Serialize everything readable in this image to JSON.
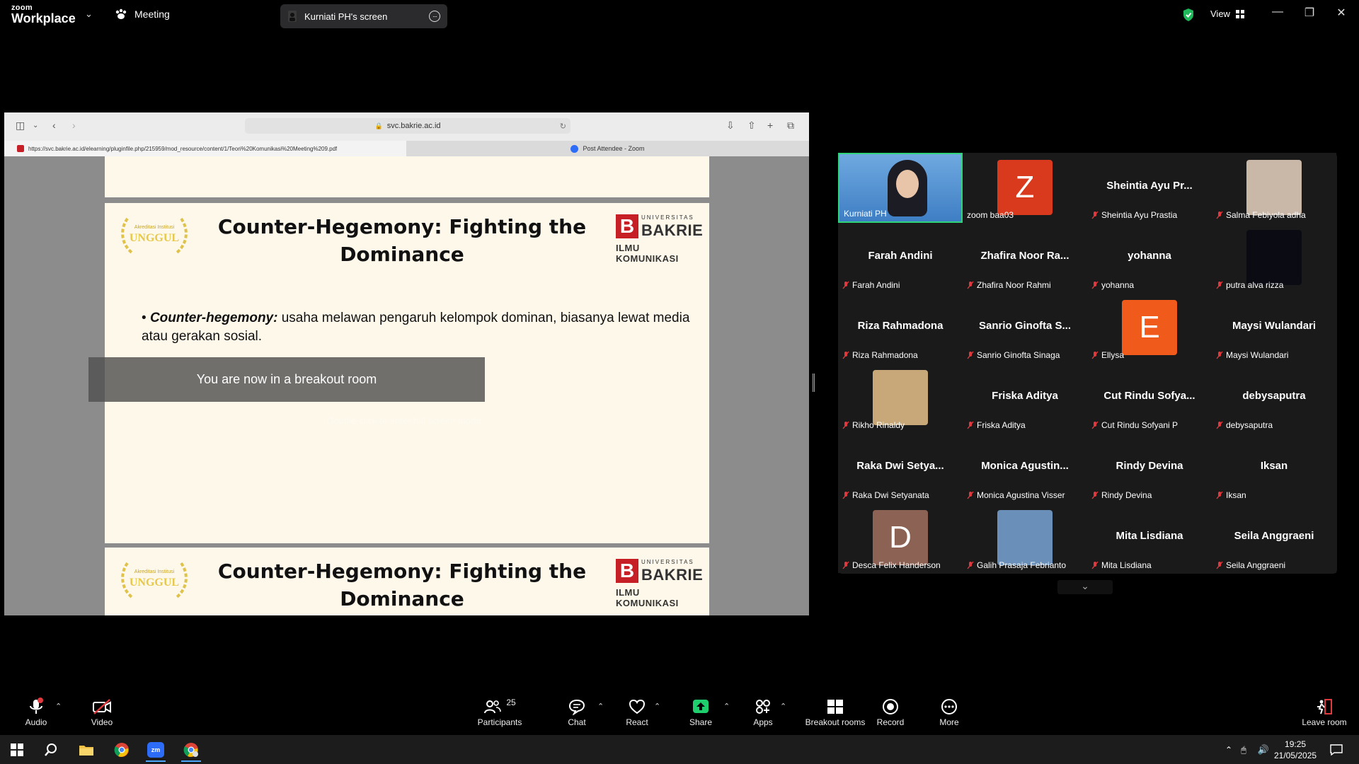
{
  "app": {
    "brand_small": "zoom",
    "brand_big": "Workplace",
    "meeting_label": "Meeting",
    "screen_share_title": "Kurniati PH's screen",
    "view_label": "View"
  },
  "browser": {
    "address": "svc.bakrie.ac.id",
    "tab_active_url": "https://svc.bakrie.ac.id/elearning/pluginfile.php/215959/mod_resource/content/1/Teori%20Komunikasi%20Meeting%209.pdf",
    "tab_other": "Post Attendee - Zoom"
  },
  "slide": {
    "badge_small": "Akreditasi Institusi",
    "badge_big": "UNGGUL",
    "title": "Counter-Hegemony: Fighting the Dominance",
    "uni_top": "UNIVERSITAS",
    "uni_name": "BAKRIE",
    "uni_dept": "ILMU KOMUNIKASI",
    "uni_letter": "B",
    "bullet_term": "Counter-hegemony:",
    "bullet_text": " usaha melawan pengaruh kelompok dominan, biasanya lewat media atau gerakan sosial."
  },
  "overlay": {
    "message": "You are now in a breakout room",
    "hint": "Double-click to enter full screen mode"
  },
  "gallery": {
    "tiles": [
      {
        "name": "Kurniati PH",
        "big": "",
        "avatar": "video",
        "color": "#3a8bd6",
        "speaker": true,
        "muted": false
      },
      {
        "name": "zoom baa03",
        "big": "",
        "avatar": "Z",
        "color": "#d93a1e",
        "speaker": false,
        "muted": false
      },
      {
        "name": "Sheintia Ayu Prastia",
        "big": "Sheintia Ayu Pr...",
        "avatar": "",
        "color": "",
        "speaker": false,
        "muted": true
      },
      {
        "name": "Salma Febiyola adha",
        "big": "",
        "avatar": "photo",
        "color": "#c9b8a8",
        "speaker": false,
        "muted": true
      },
      {
        "name": "Farah Andini",
        "big": "Farah Andini",
        "avatar": "",
        "color": "",
        "speaker": false,
        "muted": true
      },
      {
        "name": "Zhafira Noor Rahmi",
        "big": "Zhafira Noor Ra...",
        "avatar": "",
        "color": "",
        "speaker": false,
        "muted": true
      },
      {
        "name": "yohanna",
        "big": "yohanna",
        "avatar": "",
        "color": "",
        "speaker": false,
        "muted": true
      },
      {
        "name": "putra alva rizza",
        "big": "",
        "avatar": "photo",
        "color": "#0b0b14",
        "speaker": false,
        "muted": true
      },
      {
        "name": "Riza Rahmadona",
        "big": "Riza Rahmadona",
        "avatar": "",
        "color": "",
        "speaker": false,
        "muted": true
      },
      {
        "name": "Sanrio Ginofta Sinaga",
        "big": "Sanrio Ginofta S...",
        "avatar": "",
        "color": "",
        "speaker": false,
        "muted": true
      },
      {
        "name": "Ellysa",
        "big": "",
        "avatar": "E",
        "color": "#f05a1a",
        "speaker": false,
        "muted": true
      },
      {
        "name": "Maysi Wulandari",
        "big": "Maysi Wulandari",
        "avatar": "",
        "color": "",
        "speaker": false,
        "muted": true
      },
      {
        "name": "Rikho Rinaldy",
        "big": "",
        "avatar": "photo",
        "color": "#c8a878",
        "speaker": false,
        "muted": true
      },
      {
        "name": "Friska Aditya",
        "big": "Friska Aditya",
        "avatar": "",
        "color": "",
        "speaker": false,
        "muted": true
      },
      {
        "name": "Cut Rindu Sofyani P",
        "big": "Cut Rindu Sofya...",
        "avatar": "",
        "color": "",
        "speaker": false,
        "muted": true
      },
      {
        "name": "debysaputra",
        "big": "debysaputra",
        "avatar": "",
        "color": "",
        "speaker": false,
        "muted": true
      },
      {
        "name": "Raka Dwi Setyanata",
        "big": "Raka Dwi Setya...",
        "avatar": "",
        "color": "",
        "speaker": false,
        "muted": true
      },
      {
        "name": "Monica Agustina Visser",
        "big": "Monica Agustin...",
        "avatar": "",
        "color": "",
        "speaker": false,
        "muted": true
      },
      {
        "name": "Rindy Devina",
        "big": "Rindy Devina",
        "avatar": "",
        "color": "",
        "speaker": false,
        "muted": true
      },
      {
        "name": "Iksan",
        "big": "Iksan",
        "avatar": "",
        "color": "",
        "speaker": false,
        "muted": true
      },
      {
        "name": "Desca Felix Handerson",
        "big": "",
        "avatar": "D",
        "color": "#8c6254",
        "speaker": false,
        "muted": true
      },
      {
        "name": "Galih Prasaja Febrianto",
        "big": "",
        "avatar": "photo",
        "color": "#6a8fb8",
        "speaker": false,
        "muted": true
      },
      {
        "name": "Mita Lisdiana",
        "big": "Mita Lisdiana",
        "avatar": "",
        "color": "",
        "speaker": false,
        "muted": true
      },
      {
        "name": "Seila Anggraeni",
        "big": "Seila Anggraeni",
        "avatar": "",
        "color": "",
        "speaker": false,
        "muted": true
      }
    ]
  },
  "toolbar": {
    "audio": "Audio",
    "video": "Video",
    "participants": "Participants",
    "participants_count": "25",
    "chat": "Chat",
    "react": "React",
    "share": "Share",
    "apps": "Apps",
    "breakout": "Breakout rooms",
    "record": "Record",
    "more": "More",
    "leave": "Leave room"
  },
  "taskbar": {
    "time": "19:25",
    "date": "21/05/2025"
  },
  "colors": {
    "speaker_border": "#2fd37a",
    "share_green": "#1fcf6e",
    "mute_red": "#e0393e",
    "zoom_blue": "#2d6cf6"
  }
}
